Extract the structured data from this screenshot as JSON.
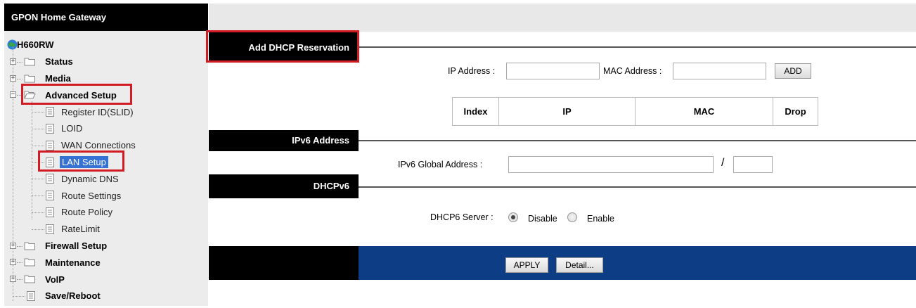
{
  "sidebar": {
    "header": "GPON Home Gateway",
    "device": "H660RW",
    "items": [
      {
        "label": "Status",
        "level": 0
      },
      {
        "label": "Media",
        "level": 0
      },
      {
        "label": "Advanced Setup",
        "level": 0,
        "expanded": true
      },
      {
        "label": "Register ID(SLID)",
        "level": 1
      },
      {
        "label": "LOID",
        "level": 1
      },
      {
        "label": "WAN Connections",
        "level": 1
      },
      {
        "label": "LAN Setup",
        "level": 1,
        "selected": true
      },
      {
        "label": "Dynamic DNS",
        "level": 1
      },
      {
        "label": "Route Settings",
        "level": 1
      },
      {
        "label": "Route Policy",
        "level": 1
      },
      {
        "label": "RateLimit",
        "level": 1
      },
      {
        "label": "Firewall Setup",
        "level": 0
      },
      {
        "label": "Maintenance",
        "level": 0
      },
      {
        "label": "VoIP",
        "level": 0
      },
      {
        "label": "Save/Reboot",
        "level": 0,
        "leaf": true
      }
    ]
  },
  "sections": {
    "add_dhcp": {
      "title": "Add DHCP Reservation",
      "ip_label": "IP Address :",
      "ip_value": "",
      "mac_label": "MAC Address :",
      "mac_value": "",
      "add_button": "ADD",
      "table_headers": [
        "Index",
        "IP",
        "MAC",
        "Drop"
      ]
    },
    "ipv6": {
      "title": "IPv6 Address",
      "global_label": "IPv6 Global Address :",
      "global_value": "",
      "separator": "/",
      "prefix_value": ""
    },
    "dhcpv6": {
      "title": "DHCPv6",
      "server_label": "DHCP6 Server :",
      "options": [
        "Disable",
        "Enable"
      ],
      "selected": "Disable"
    }
  },
  "footer": {
    "apply_button": "APPLY",
    "detail_button": "Detail..."
  },
  "colors": {
    "highlight": "#d11b25",
    "footer_blue": "#0d3d85",
    "selection": "#3572d4"
  }
}
